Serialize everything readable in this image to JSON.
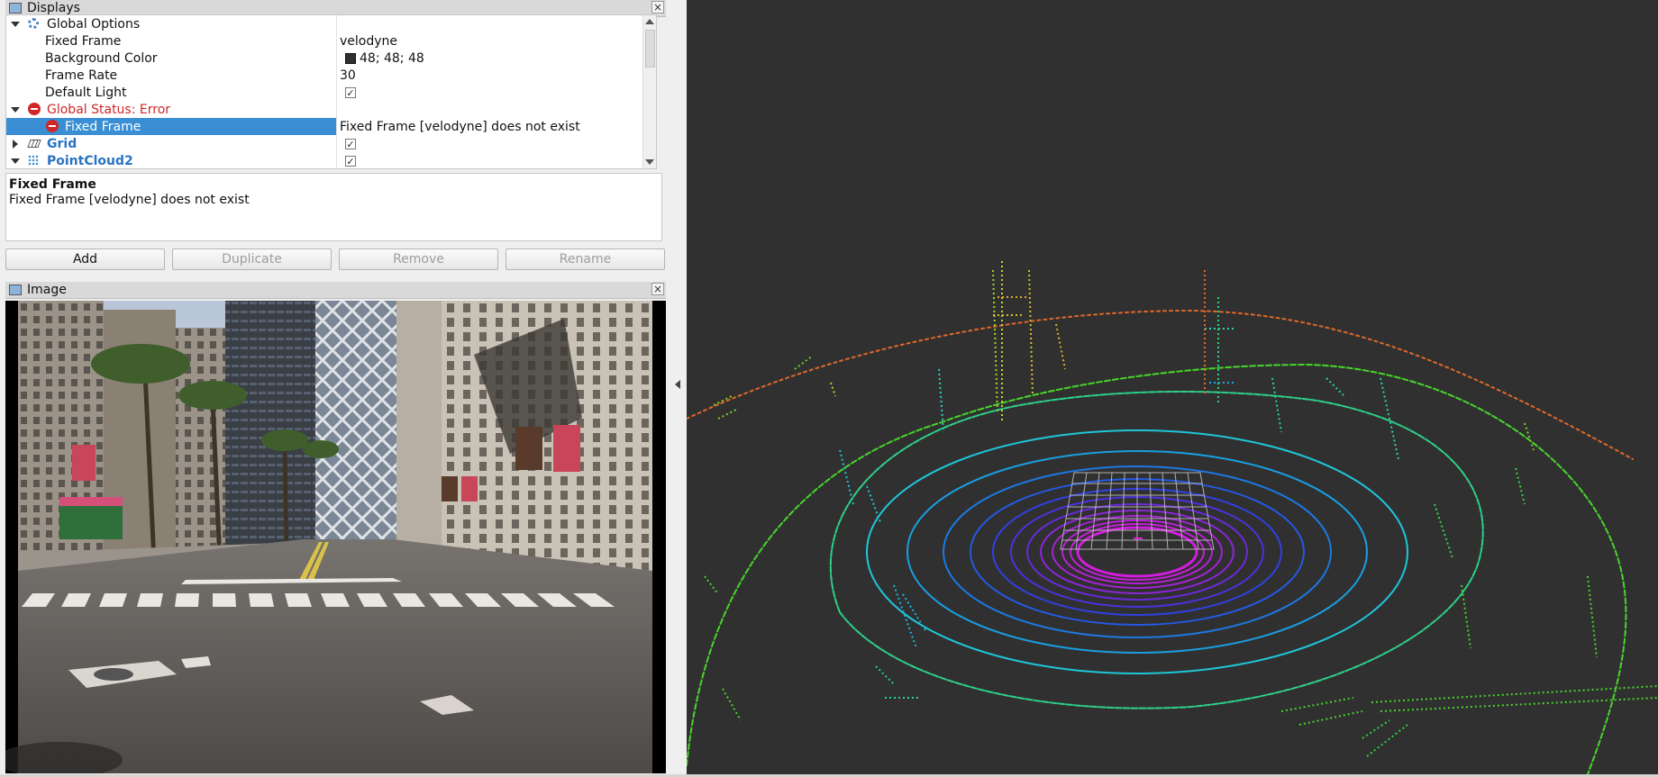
{
  "displays_panel": {
    "title": "Displays",
    "close_glyph": "×",
    "rows": [
      {
        "name": "Global Options",
        "icon": "gear-icon",
        "expanded": true
      },
      {
        "name": "Fixed Frame",
        "value": "velodyne"
      },
      {
        "name": "Background Color",
        "value": "48; 48; 48",
        "color": "#303030"
      },
      {
        "name": "Frame Rate",
        "value": "30"
      },
      {
        "name": "Default Light",
        "checked": true
      },
      {
        "name": "Global Status: Error",
        "icon": "error-icon",
        "expanded": true,
        "color": "#d02626"
      },
      {
        "name": "Fixed Frame",
        "icon": "error-icon",
        "value": "Fixed Frame [velodyne] does not exist",
        "selected": true
      },
      {
        "name": "Grid",
        "icon": "grid-icon",
        "expanded": false,
        "checked": true
      },
      {
        "name": "PointCloud2",
        "icon": "pointcloud-icon",
        "expanded": true,
        "checked": true
      }
    ],
    "check_glyph": "✓"
  },
  "description": {
    "title": "Fixed Frame",
    "text": "Fixed Frame [velodyne] does not exist"
  },
  "buttons": {
    "add": "Add",
    "duplicate": "Duplicate",
    "remove": "Remove",
    "rename": "Rename"
  },
  "image_panel": {
    "title": "Image",
    "close_glyph": "×"
  },
  "viewport": {
    "background_color": "#303030",
    "background_rgb": "48; 48; 48",
    "selection_color": "#3a8fd4",
    "error_color": "#d02626"
  }
}
